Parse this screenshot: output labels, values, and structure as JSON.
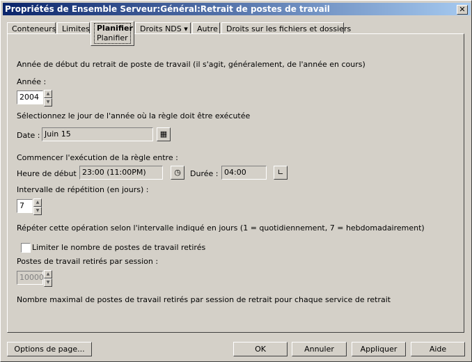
{
  "window": {
    "title": "Propriétés de Ensemble Serveur:Général:Retrait de postes de travail",
    "close": "✕"
  },
  "tabs": [
    {
      "label": "Conteneurs"
    },
    {
      "label": "Limites"
    },
    {
      "label": "Planifier",
      "sub": "Planifier"
    },
    {
      "label": "Droits NDS ▾"
    },
    {
      "label": "Autre"
    },
    {
      "label": "Droits sur les fichiers et dossiers"
    }
  ],
  "form": {
    "intro": "Année de début du retrait de poste de travail (il s'agit, généralement, de l'année en cours)",
    "year_label": "Année :",
    "year_value": "2004",
    "day_text": "Sélectionnez le jour de l'année où la règle doit être exécutée",
    "date_label": "Date :",
    "date_value": "Juin 15",
    "start_text": "Commencer l'exécution de la règle entre :",
    "start_label": "Heure de début :",
    "start_value": "23:00 (11:00PM)",
    "duration_label": "Durée :",
    "duration_value": "04:00",
    "interval_label": "Intervalle de répétition (en jours) :",
    "interval_value": "7",
    "repeat_text": "Répéter cette opération selon l'intervalle indiqué en jours (1 = quotidiennement, 7 = hebdomadairement)",
    "limit_label": "Limiter le nombre de postes de travail retirés",
    "limit_checked": false,
    "per_session_label": "Postes de travail retirés par session :",
    "per_session_value": "10000",
    "max_text": "Nombre maximal de postes de travail retirés par session de retrait pour chaque service de retrait"
  },
  "buttons": {
    "page_options": "Options de page...",
    "ok": "OK",
    "cancel": "Annuler",
    "apply": "Appliquer",
    "help": "Aide"
  }
}
